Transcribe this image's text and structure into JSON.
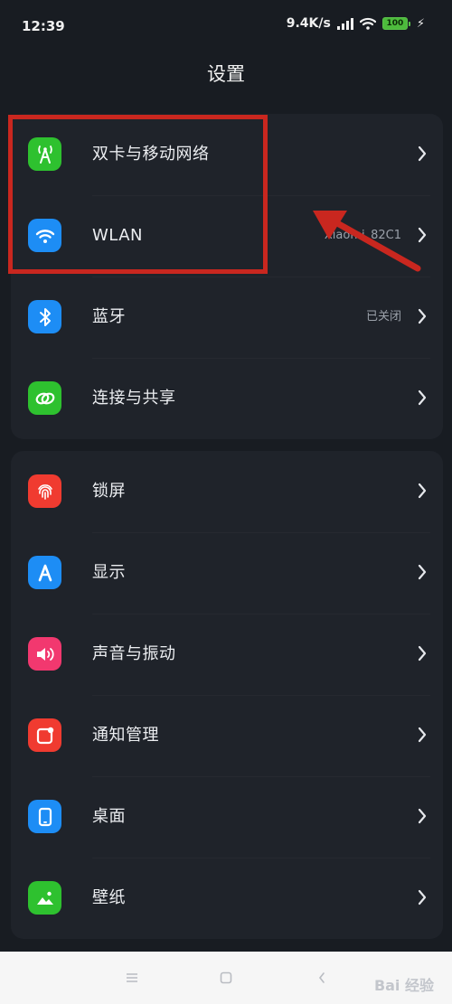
{
  "status": {
    "time": "12:39",
    "speed": "9.4K/s",
    "battery": "100"
  },
  "title": "设置",
  "groups": [
    {
      "items": [
        {
          "label": "双卡与移动网络",
          "value": "",
          "icon": "cellular-antenna-icon",
          "color": "#2ec12f"
        },
        {
          "label": "WLAN",
          "value": "Xiaomi_82C1",
          "icon": "wifi-icon",
          "color": "#1d8df5"
        },
        {
          "label": "蓝牙",
          "value": "已关闭",
          "icon": "bluetooth-icon",
          "color": "#1d8df5"
        },
        {
          "label": "连接与共享",
          "value": "",
          "icon": "link-icon",
          "color": "#2ec12f"
        }
      ]
    },
    {
      "items": [
        {
          "label": "锁屏",
          "value": "",
          "icon": "fingerprint-icon",
          "color": "#f03b30"
        },
        {
          "label": "显示",
          "value": "",
          "icon": "display-a-icon",
          "color": "#1d8df5"
        },
        {
          "label": "声音与振动",
          "value": "",
          "icon": "speaker-icon",
          "color": "#f2386f"
        },
        {
          "label": "通知管理",
          "value": "",
          "icon": "notification-icon",
          "color": "#f03b30"
        },
        {
          "label": "桌面",
          "value": "",
          "icon": "phone-desktop-icon",
          "color": "#1d8df5"
        },
        {
          "label": "壁纸",
          "value": "",
          "icon": "wallpaper-icon",
          "color": "#2ec12f"
        }
      ]
    }
  ],
  "watermark": "Bai 经验"
}
